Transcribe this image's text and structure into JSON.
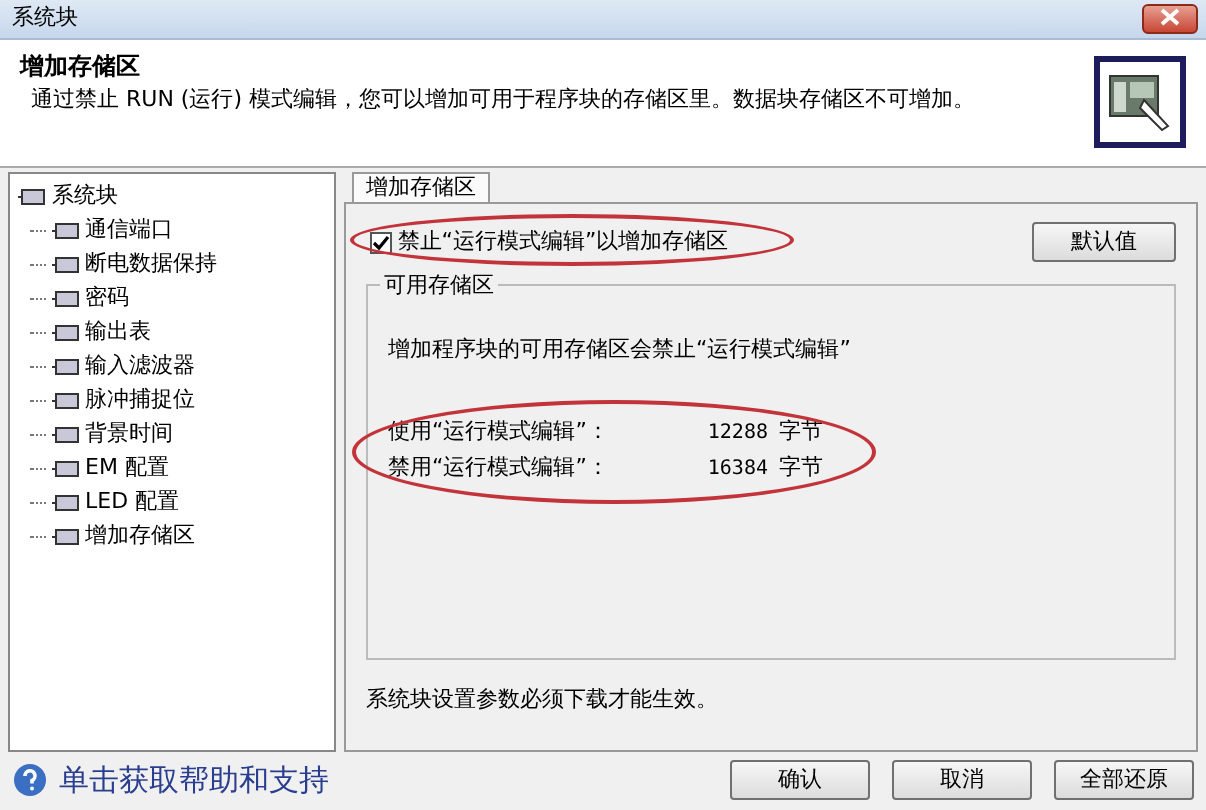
{
  "window": {
    "title": "系统块"
  },
  "header": {
    "title": "增加存储区",
    "description": "通过禁止 RUN (运行) 模式编辑，您可以增加可用于程序块的存储区里。数据块存储区不可增加。"
  },
  "tree": {
    "label": "系统块",
    "children": [
      {
        "label": "通信端口"
      },
      {
        "label": "断电数据保持"
      },
      {
        "label": "密码"
      },
      {
        "label": "输出表"
      },
      {
        "label": "输入滤波器"
      },
      {
        "label": "脉冲捕捉位"
      },
      {
        "label": "背景时间"
      },
      {
        "label": "EM 配置"
      },
      {
        "label": "LED 配置"
      },
      {
        "label": "增加存储区"
      }
    ]
  },
  "tabs": [
    {
      "label": "增加存储区",
      "selected": true
    }
  ],
  "checkbox": {
    "label": "禁止“运行模式编辑”以增加存储区",
    "checked": true
  },
  "default_button": "默认值",
  "group": {
    "title": "可用存储区",
    "note": "增加程序块的可用存储区会禁止“运行模式编辑”",
    "rows": [
      {
        "label": "使用“运行模式编辑”：",
        "value": "12288",
        "unit": "字节"
      },
      {
        "label": "禁用“运行模式编辑”：",
        "value": "16384",
        "unit": "字节"
      }
    ]
  },
  "footer_note": "系统块设置参数必须下载才能生效。",
  "help_link": "单击获取帮助和支持",
  "buttons": [
    "确认",
    "取消",
    "全部还原"
  ]
}
